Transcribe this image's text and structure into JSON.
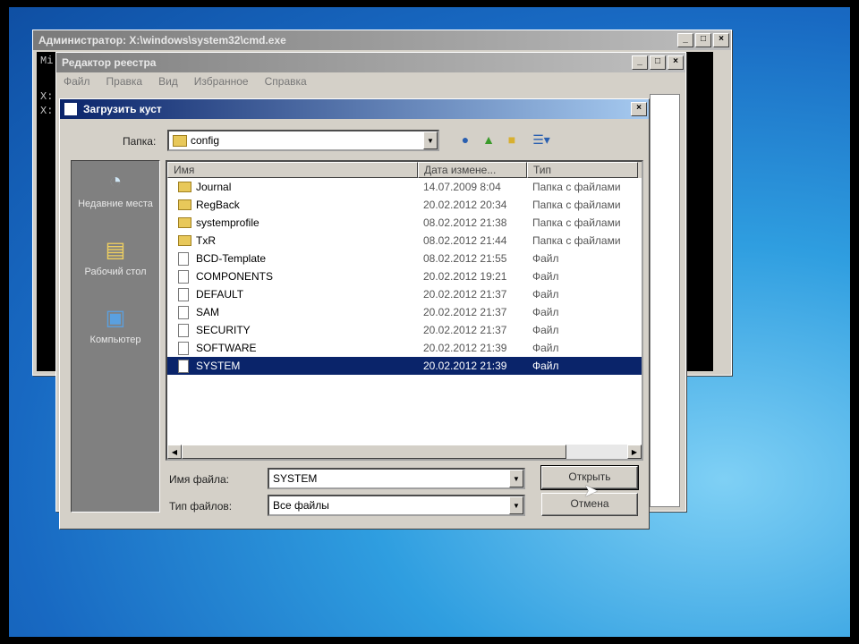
{
  "cmd_window": {
    "title": "Администратор: X:\\windows\\system32\\cmd.exe",
    "lines": [
      "Mi",
      "X:",
      "X:"
    ]
  },
  "regedit_window": {
    "title": "Редактор реестра",
    "menu": [
      "Файл",
      "Правка",
      "Вид",
      "Избранное",
      "Справка"
    ]
  },
  "dialog": {
    "title": "Загрузить куст",
    "lookin_label": "Папка:",
    "lookin_value": "config",
    "columns": [
      "Имя",
      "Дата измене...",
      "Тип"
    ],
    "files": [
      {
        "name": "Journal",
        "date": "14.07.2009 8:04",
        "type": "Папка с файлами",
        "kind": "folder"
      },
      {
        "name": "RegBack",
        "date": "20.02.2012 20:34",
        "type": "Папка с файлами",
        "kind": "folder"
      },
      {
        "name": "systemprofile",
        "date": "08.02.2012 21:38",
        "type": "Папка с файлами",
        "kind": "folder"
      },
      {
        "name": "TxR",
        "date": "08.02.2012 21:44",
        "type": "Папка с файлами",
        "kind": "folder"
      },
      {
        "name": "BCD-Template",
        "date": "08.02.2012 21:55",
        "type": "Файл",
        "kind": "file"
      },
      {
        "name": "COMPONENTS",
        "date": "20.02.2012 19:21",
        "type": "Файл",
        "kind": "file"
      },
      {
        "name": "DEFAULT",
        "date": "20.02.2012 21:37",
        "type": "Файл",
        "kind": "file"
      },
      {
        "name": "SAM",
        "date": "20.02.2012 21:37",
        "type": "Файл",
        "kind": "file"
      },
      {
        "name": "SECURITY",
        "date": "20.02.2012 21:37",
        "type": "Файл",
        "kind": "file"
      },
      {
        "name": "SOFTWARE",
        "date": "20.02.2012 21:39",
        "type": "Файл",
        "kind": "file"
      },
      {
        "name": "SYSTEM",
        "date": "20.02.2012 21:39",
        "type": "Файл",
        "kind": "file",
        "selected": true
      }
    ],
    "places": [
      "Недавние места",
      "Рабочий стол",
      "Компьютер"
    ],
    "filename_label": "Имя файла:",
    "filename_value": "SYSTEM",
    "filetype_label": "Тип файлов:",
    "filetype_value": "Все файлы",
    "open_button": "Открыть",
    "cancel_button": "Отмена"
  }
}
